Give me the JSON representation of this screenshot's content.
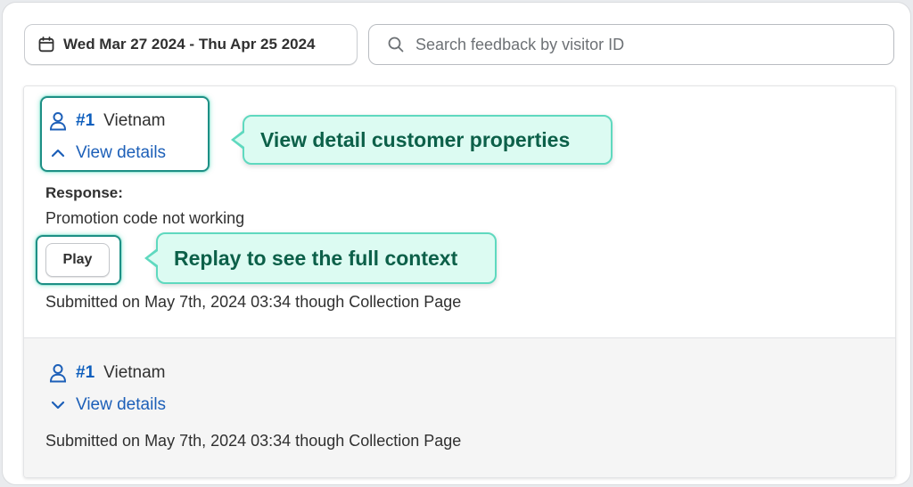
{
  "filters": {
    "date_range": "Wed Mar 27 2024 - Thu Apr 25 2024",
    "search_placeholder": "Search feedback by visitor ID",
    "search_value": ""
  },
  "feedback": [
    {
      "visitor_id": "#1",
      "country": "Vietnam",
      "details_label": "View details",
      "expanded": true,
      "response_label": "Response:",
      "response_text": "Promotion code not working",
      "play_label": "Play",
      "submitted": "Submitted on May 7th, 2024 03:34 though Collection Page"
    },
    {
      "visitor_id": "#1",
      "country": "Vietnam",
      "details_label": "View details",
      "expanded": false,
      "submitted": "Submitted on May 7th, 2024 03:34 though Collection Page"
    }
  ],
  "callouts": {
    "details": "View detail customer properties",
    "replay": "Replay to see the full context"
  },
  "colors": {
    "link_blue": "#1c5fb8",
    "highlight_teal": "#1d8f85",
    "callout_bg": "#dcfbf2",
    "callout_text": "#0c6049"
  },
  "icons": {
    "date": "calendar-icon",
    "search": "search-icon",
    "visitor": "user-icon",
    "collapse": "chevron-up-icon",
    "expand": "chevron-down-icon"
  }
}
